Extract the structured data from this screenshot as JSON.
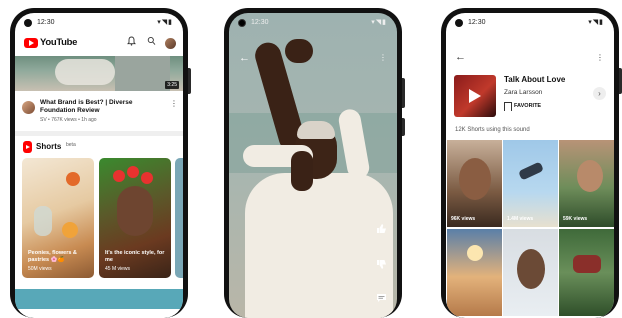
{
  "phone1": {
    "status": {
      "time": "12:30",
      "icons": "▾◥▮"
    },
    "header": {
      "brand": "YouTube",
      "bell_icon": "bell-icon",
      "search_icon": "search-icon"
    },
    "featured_video": {
      "duration": "3:25",
      "title": "What Brand is Best? | Diverse Foundation Review",
      "meta": "SV • 767K views • 1h ago"
    },
    "shorts": {
      "label": "Shorts",
      "badge": "beta",
      "cards": [
        {
          "caption": "Peonies, flowers & pastries 🌸🍊",
          "views": "50M views"
        },
        {
          "caption": "It's the iconic style, for me",
          "views": "45 M views"
        }
      ]
    }
  },
  "phone2": {
    "status": {
      "time": "12:30",
      "icons": "▾◥▮"
    }
  },
  "phone3": {
    "status": {
      "time": "12:30",
      "icons": "▾◥▮"
    },
    "sound": {
      "title": "Talk About Love",
      "artist": "Zara Larsson",
      "favorite_label": "FAVORITE"
    },
    "count_text": "12K Shorts using this sound",
    "grid": [
      {
        "views": "96K views"
      },
      {
        "views": "1.4M views"
      },
      {
        "views": "59K views"
      },
      {
        "views": ""
      },
      {
        "views": ""
      },
      {
        "views": ""
      }
    ]
  },
  "colors": {
    "youtube_red": "#ff0000",
    "frame": "#111111"
  }
}
